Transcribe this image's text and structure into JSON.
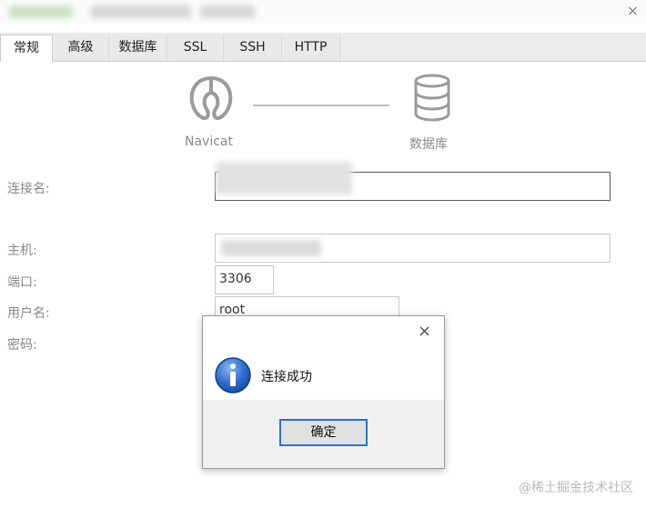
{
  "window": {
    "close_glyph": "×"
  },
  "tabs": [
    {
      "label": "常规",
      "active": true
    },
    {
      "label": "高级",
      "active": false
    },
    {
      "label": "数据库",
      "active": false
    },
    {
      "label": "SSL",
      "active": false
    },
    {
      "label": "SSH",
      "active": false
    },
    {
      "label": "HTTP",
      "active": false
    }
  ],
  "diagram": {
    "left_label": "Navicat",
    "right_label": "数据库",
    "left_icon": "navicat-logo-icon",
    "right_icon": "database-icon"
  },
  "form": {
    "connection_name_label": "连接名:",
    "host_label": "主机:",
    "port_label": "端口:",
    "port_value": "3306",
    "username_label": "用户名:",
    "username_value": "root",
    "password_label": "密码:"
  },
  "dialog": {
    "close_glyph": "×",
    "message": "连接成功",
    "ok_label": "确定",
    "icon": "info-icon"
  },
  "watermark": "@稀土掘金技术社区",
  "colors": {
    "accent": "#2a73c9",
    "info_blue": "#1d5fc2",
    "icon_gray": "#9a9a9a"
  }
}
